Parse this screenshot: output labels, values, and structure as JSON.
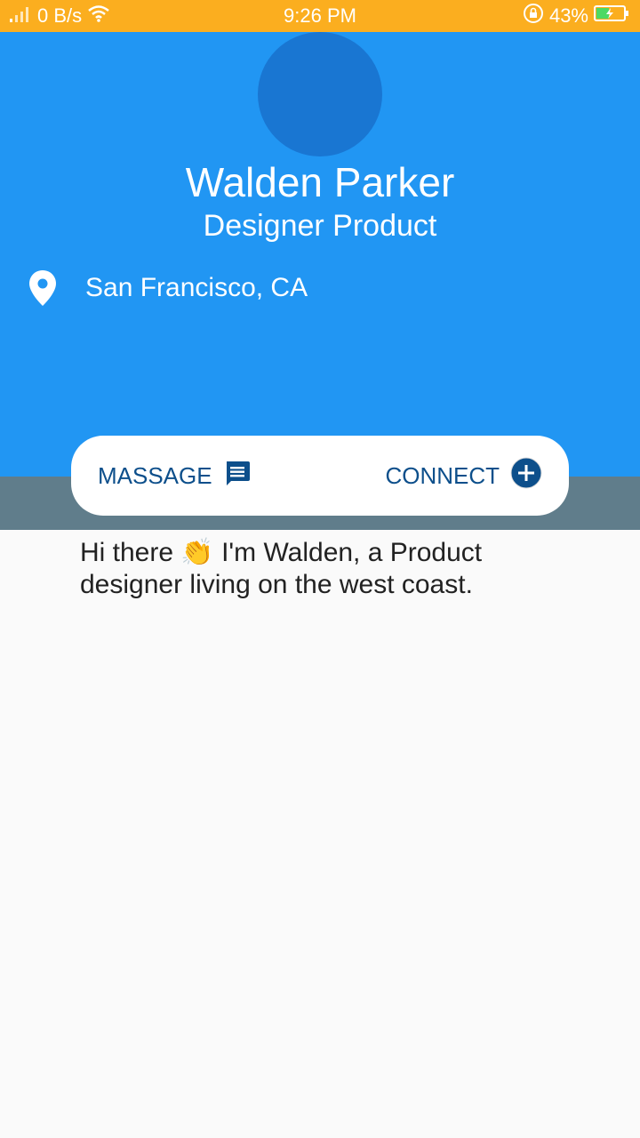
{
  "status_bar": {
    "network_speed": "0 B/s",
    "time": "9:26 PM",
    "battery_percent": "43%",
    "icons": [
      "signal-icon",
      "wifi-icon",
      "rotation-lock-icon",
      "battery-charging-icon"
    ],
    "battery_level": 0.43
  },
  "profile": {
    "name": "Walden Parker",
    "title": "Designer Product",
    "location": "San Francisco, CA"
  },
  "actions": {
    "message_label": "MASSAGE",
    "message_icon": "message-icon",
    "connect_label": "CONNECT",
    "connect_icon": "add-circle-icon"
  },
  "bio": {
    "text": "Hi there 👏 I'm Walden, a Product designer living on the west coast."
  },
  "colors": {
    "status_bar": "#FBAE1F",
    "header": "#2196F3",
    "avatar": "#1976D2",
    "strip": "#607D8B",
    "action_text": "#0D4F8B",
    "background": "#FAFAFA"
  }
}
